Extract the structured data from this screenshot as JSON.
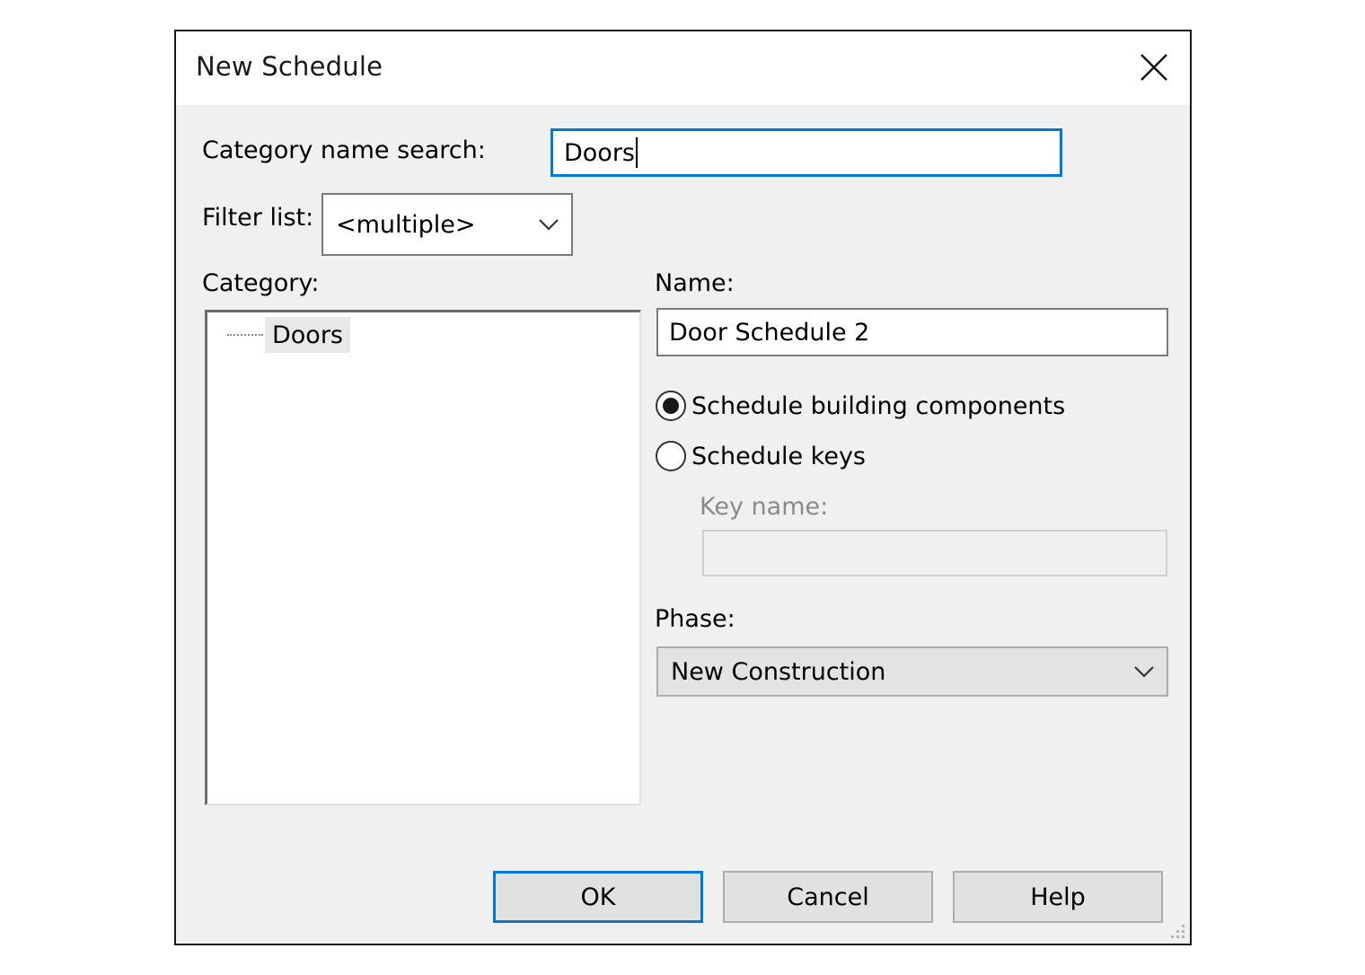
{
  "dialog": {
    "title": "New Schedule",
    "close_icon": "close-icon"
  },
  "search": {
    "label": "Category name search:",
    "value": "Doors"
  },
  "filter": {
    "label": "Filter list:",
    "selected": "<multiple>",
    "icon": "chevron-down-icon"
  },
  "category": {
    "label": "Category:",
    "items": [
      "Doors"
    ]
  },
  "name": {
    "label": "Name:",
    "value": "Door Schedule 2"
  },
  "schedule_type": {
    "options": [
      {
        "label": "Schedule building components",
        "checked": true
      },
      {
        "label": "Schedule keys",
        "checked": false
      }
    ],
    "key_name_label": "Key name:",
    "key_name_value": ""
  },
  "phase": {
    "label": "Phase:",
    "selected": "New Construction",
    "icon": "chevron-down-icon"
  },
  "buttons": {
    "ok": "OK",
    "cancel": "Cancel",
    "help": "Help"
  },
  "colors": {
    "focus_accent": "#0078d7",
    "dialog_background": "#f0f0f0",
    "button_face": "#e1e1e1"
  }
}
